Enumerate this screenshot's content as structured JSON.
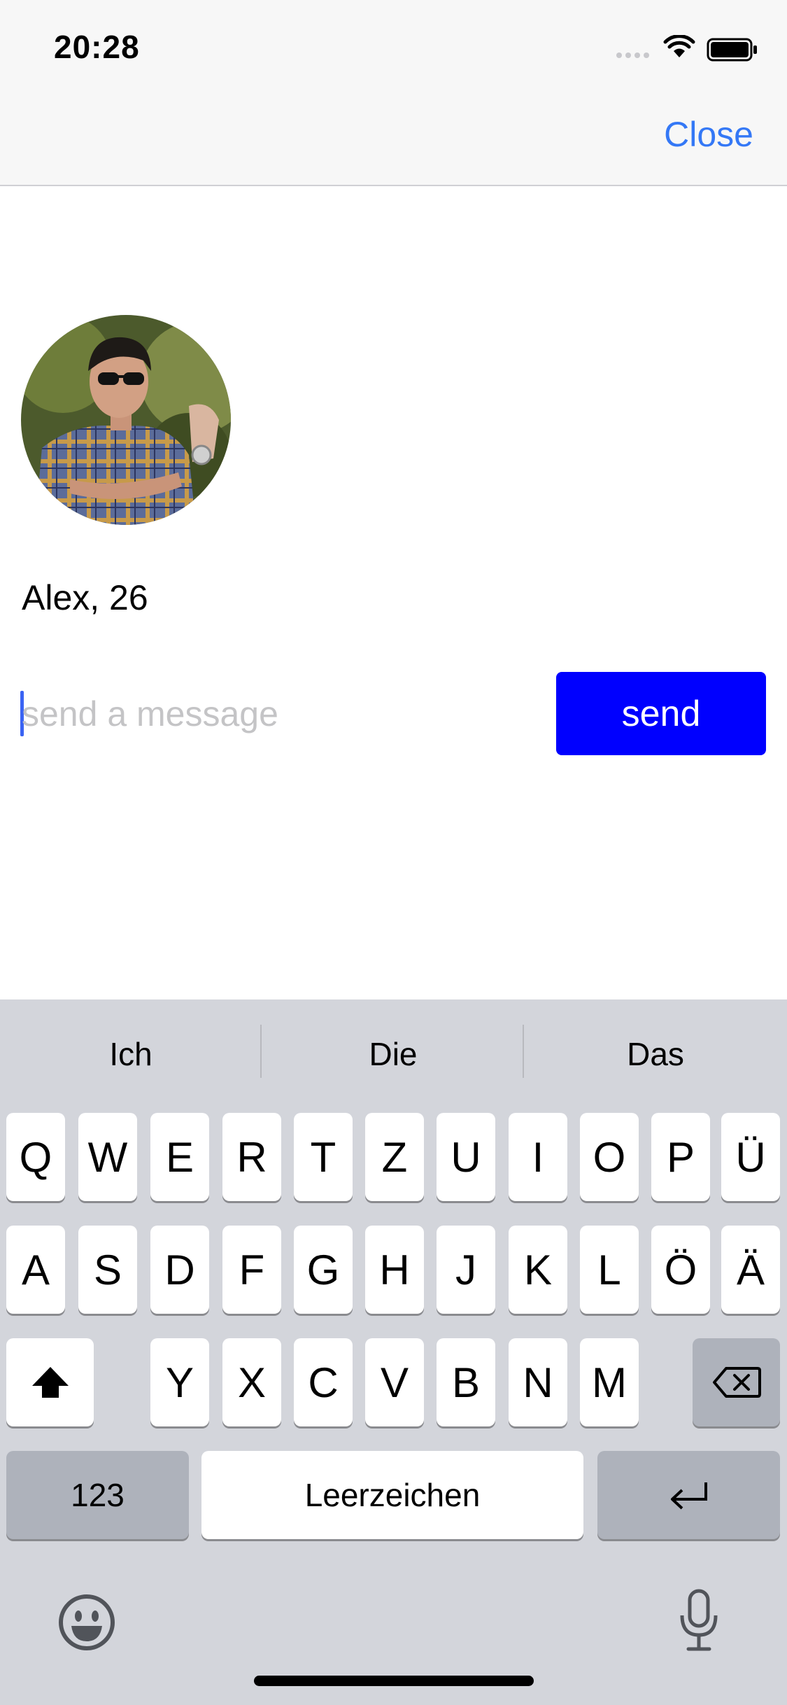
{
  "status_bar": {
    "time": "20:28"
  },
  "nav": {
    "close_label": "Close"
  },
  "profile": {
    "name_age": "Alex, 26",
    "avatar_icon": "profile-photo"
  },
  "message": {
    "placeholder": "send a message",
    "value": "",
    "send_label": "send"
  },
  "keyboard": {
    "suggestions": [
      "Ich",
      "Die",
      "Das"
    ],
    "row1": [
      "Q",
      "W",
      "E",
      "R",
      "T",
      "Z",
      "U",
      "I",
      "O",
      "P",
      "Ü"
    ],
    "row2": [
      "A",
      "S",
      "D",
      "F",
      "G",
      "H",
      "J",
      "K",
      "L",
      "Ö",
      "Ä"
    ],
    "row3": [
      "Y",
      "X",
      "C",
      "V",
      "B",
      "N",
      "M"
    ],
    "numbers_label": "123",
    "space_label": "Leerzeichen",
    "icons": {
      "shift": "shift-icon",
      "delete": "delete-icon",
      "return": "return-icon",
      "emoji": "emoji-icon",
      "mic": "microphone-icon"
    }
  },
  "colors": {
    "accent": "#3478f6",
    "send_bg": "#0000ff",
    "keyboard_bg": "#d3d5db",
    "cursor": "#3a63f3"
  }
}
